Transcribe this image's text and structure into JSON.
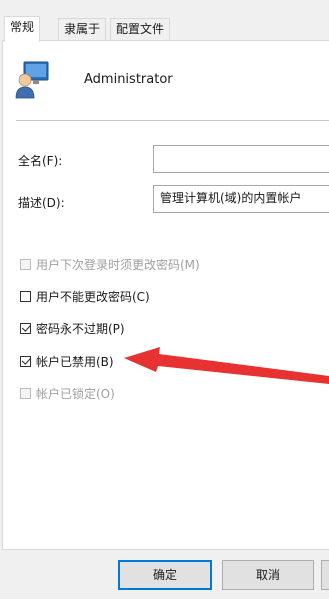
{
  "tabs": [
    {
      "label": "常规",
      "active": true
    },
    {
      "label": "隶属于",
      "active": false
    },
    {
      "label": "配置文件",
      "active": false
    }
  ],
  "user": {
    "icon": "user-computer-icon",
    "name": "Administrator"
  },
  "fields": {
    "full_name": {
      "label": "全名(F):",
      "value": ""
    },
    "description": {
      "label": "描述(D):",
      "value": "管理计算机(域)的内置帐户"
    }
  },
  "options": [
    {
      "label": "用户下次登录时须更改密码(M)",
      "checked": false,
      "disabled": true
    },
    {
      "label": "用户不能更改密码(C)",
      "checked": false,
      "disabled": false
    },
    {
      "label": "密码永不过期(P)",
      "checked": true,
      "disabled": false
    },
    {
      "label": "帐户已禁用(B)",
      "checked": true,
      "disabled": false
    },
    {
      "label": "帐户已锁定(O)",
      "checked": false,
      "disabled": true
    }
  ],
  "buttons": {
    "ok": "确定",
    "cancel": "取消"
  },
  "colors": {
    "annotation_arrow": "#e83232",
    "default_button_border": "#0078d7"
  }
}
